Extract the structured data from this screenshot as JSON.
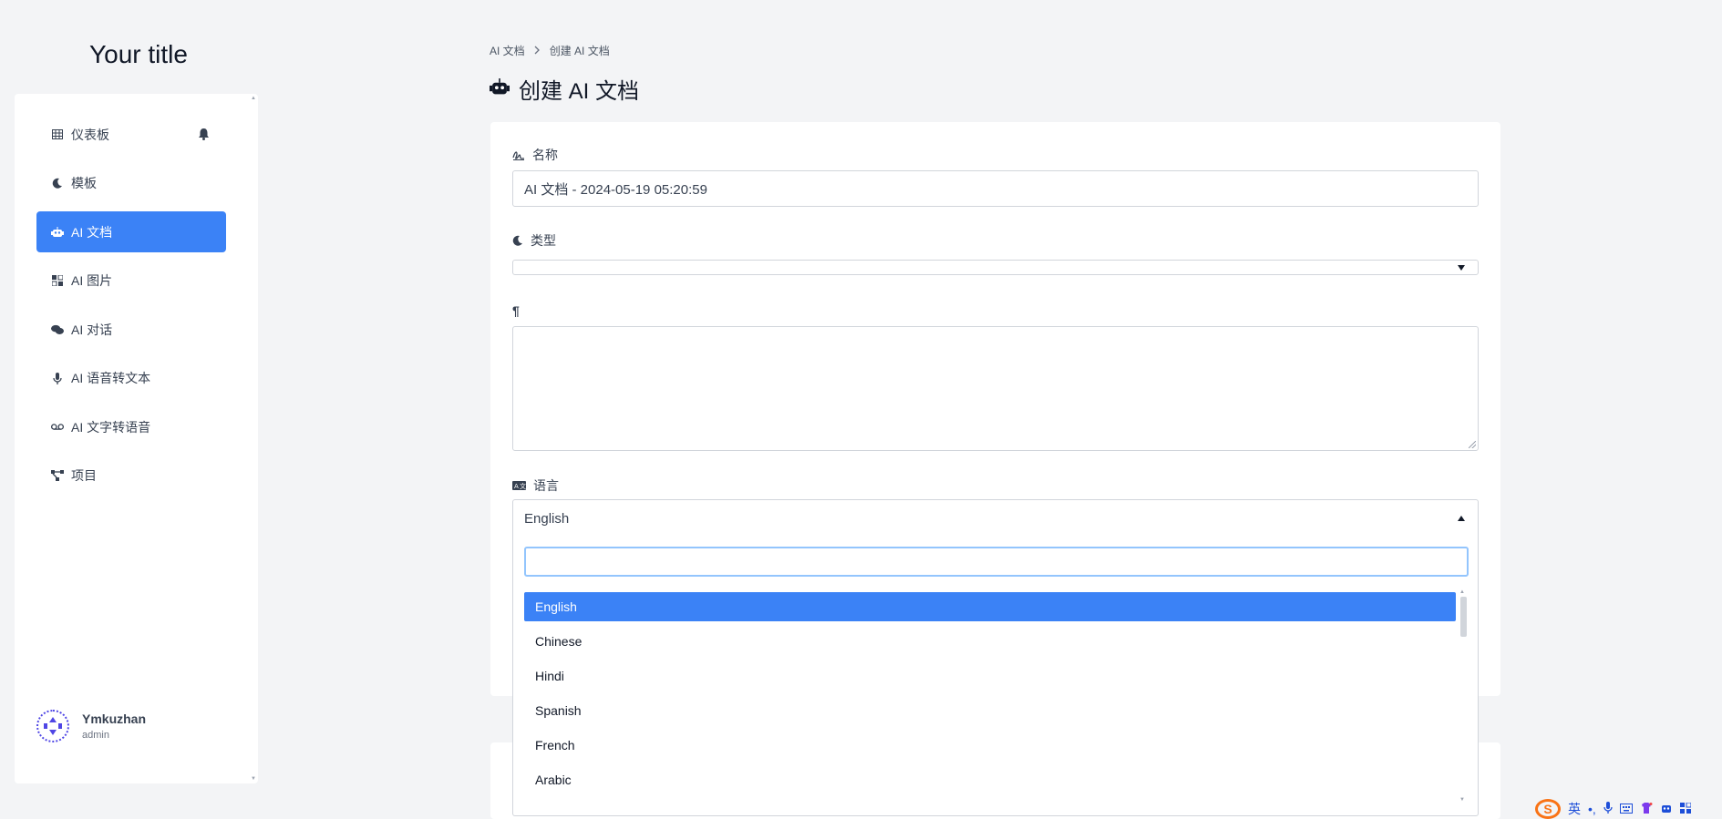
{
  "app": {
    "title": "Your title"
  },
  "sidebar": {
    "items": [
      {
        "label": "仪表板",
        "icon": "table-icon"
      },
      {
        "label": "模板",
        "icon": "moon-icon"
      },
      {
        "label": "AI 文档",
        "icon": "robot-icon",
        "active": true
      },
      {
        "label": "AI 图片",
        "icon": "image-grid-icon"
      },
      {
        "label": "AI 对话",
        "icon": "comments-icon"
      },
      {
        "label": "AI 语音转文本",
        "icon": "microphone-icon"
      },
      {
        "label": "AI 文字转语音",
        "icon": "voicemail-icon"
      },
      {
        "label": "项目",
        "icon": "project-diagram-icon"
      }
    ],
    "user": {
      "name": "Ymkuzhan",
      "role": "admin"
    }
  },
  "breadcrumb": {
    "items": [
      "AI 文档",
      "创建 AI 文档"
    ],
    "separator": ">"
  },
  "page": {
    "title": "创建 AI 文档"
  },
  "form": {
    "name_label": "名称",
    "name_value": "AI 文档 - 2024-05-19 05:20:59",
    "type_label": "类型",
    "type_value": "",
    "paragraph_label": "¶",
    "textarea_value": "",
    "language_label": "语言",
    "language_value": "English",
    "language_search_value": "",
    "language_options": [
      "English",
      "Chinese",
      "Hindi",
      "Spanish",
      "French",
      "Arabic"
    ]
  },
  "ime": {
    "logo": "S",
    "mode": "英"
  },
  "colors": {
    "accent": "#3b82f6",
    "background": "#f3f4f6",
    "text": "#374151"
  }
}
